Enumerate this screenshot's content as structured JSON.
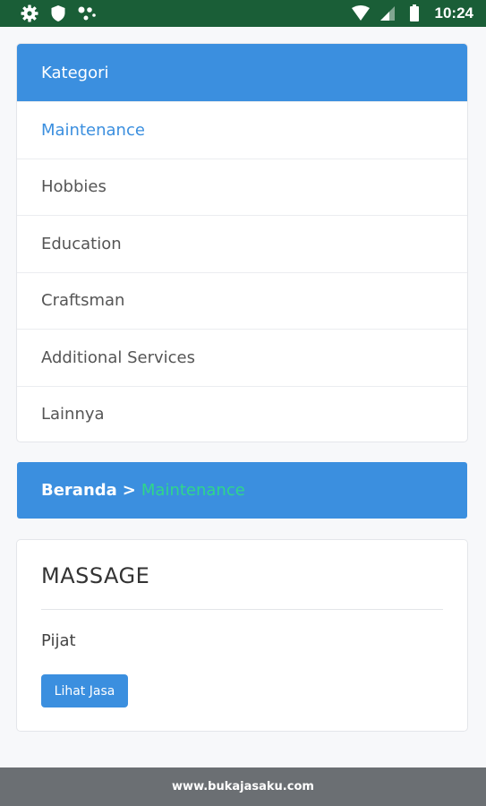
{
  "status_bar": {
    "time": "10:24",
    "left_icons": [
      "gear-icon",
      "shield-icon",
      "dots-icon"
    ],
    "right_icons": [
      "wifi-icon",
      "signal-icon",
      "battery-icon"
    ]
  },
  "kategori": {
    "title": "Kategori",
    "items": [
      {
        "label": "Maintenance",
        "active": true
      },
      {
        "label": "Hobbies",
        "active": false
      },
      {
        "label": "Education",
        "active": false
      },
      {
        "label": "Craftsman",
        "active": false
      },
      {
        "label": "Additional Services",
        "active": false
      },
      {
        "label": "Lainnya",
        "active": false
      }
    ]
  },
  "breadcrumb": {
    "home": "Beranda",
    "separator": ">",
    "current": "Maintenance"
  },
  "service": {
    "title": "MASSAGE",
    "description": "Pijat",
    "button_label": "Lihat Jasa"
  },
  "footer": {
    "text": "www.bukajasaku.com"
  },
  "colors": {
    "status_bar": "#1a5e37",
    "primary": "#3b8fdf",
    "breadcrumb_current": "#2fd68a",
    "footer": "#6b6f73"
  }
}
